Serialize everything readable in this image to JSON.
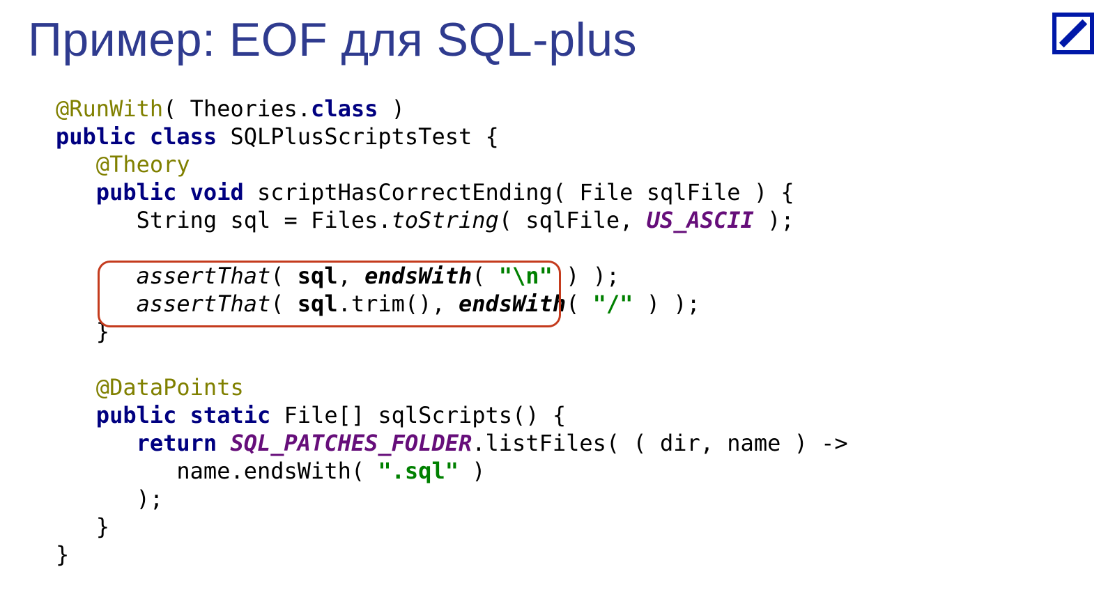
{
  "title": "Пример: EOF для SQL-plus",
  "logo": {
    "color": "#0018a8",
    "name": "deutsche-bank-logo"
  },
  "code": {
    "line1": {
      "annotation": "@RunWith",
      "text1": "( Theories.",
      "keyword": "class",
      "text2": " )"
    },
    "line2": {
      "kw1": "public",
      "kw2": "class",
      "text": " SQLPlusScriptsTest {"
    },
    "line3": {
      "annotation": "@Theory"
    },
    "line4": {
      "kw1": "public",
      "kw2": "void",
      "text": " scriptHasCorrectEnding( File sqlFile ) {"
    },
    "line5": {
      "text1": "String sql = Files.",
      "italic": "toString",
      "text2": "( sqlFile, ",
      "const": "US_ASCII",
      "text3": " );"
    },
    "line6": {
      "italic1": "assertThat",
      "text1": "( ",
      "bold1": "sql",
      "text2": ", ",
      "bolditalic": "endsWith",
      "text3": "( ",
      "string": "\"\\n\"",
      "text4": " ) );"
    },
    "line7": {
      "italic1": "assertThat",
      "text1": "( ",
      "bold1": "sql",
      "text2": ".trim(), ",
      "bolditalic": "endsWith",
      "text3": "( ",
      "string": "\"/\"",
      "text4": " ) );"
    },
    "line8": {
      "text": "}"
    },
    "line9": {
      "annotation": "@DataPoints"
    },
    "line10": {
      "kw1": "public",
      "kw2": "static",
      "text": " File[] sqlScripts() {"
    },
    "line11": {
      "kw": "return",
      "const": "SQL_PATCHES_FOLDER",
      "text": ".listFiles( ( dir, name ) ->"
    },
    "line12": {
      "text1": "name.endsWith( ",
      "string": "\".sql\"",
      "text2": " )"
    },
    "line13": {
      "text": ");"
    },
    "line14": {
      "text": "}"
    },
    "line15": {
      "text": "}"
    }
  }
}
